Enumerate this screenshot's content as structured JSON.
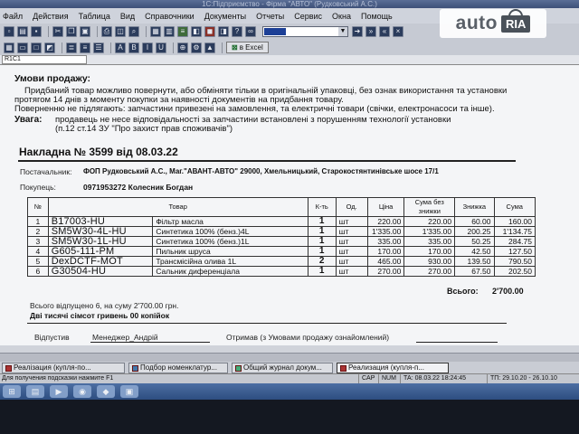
{
  "window": {
    "title": "1С:Підприємство - Фірма \"АВТО\" (Рудковський А.С.)"
  },
  "menu": [
    "Файл",
    "Действия",
    "Таблица",
    "Вид",
    "Справочники",
    "Документы",
    "Отчеты",
    "Сервис",
    "Окна",
    "Помощь"
  ],
  "toolbar": {
    "excel_label": "в Excel",
    "cell_ref": "R1C1"
  },
  "conditions": {
    "title": "Умови продажу:",
    "line1": "Придбаний товар можливо повернути, або обміняти тільки в оригінальній упаковці, без ознак використання та установки",
    "line2": "протягом 14 днів з моменту покупки за наявності документів на придбання товару.",
    "line3": "Поверненню не підлягають: запчастини привезені на замовлення, та електричні товари (свічки, електронасоси та інше).",
    "warning_label": "Увага:",
    "warning1": "продавець не несе відповідальності за запчастини встановлені з порушенням технології установки",
    "warning2": "(п.12 ст.14 ЗУ \"Про захист прав споживачів\")"
  },
  "invoice": {
    "title": "Накладна № 3599 від 08.03.22",
    "supplier_label": "Постачальник:",
    "supplier": "ФОП Рудковський А.С., Маг.\"АВАНТ-АВТО\" 29000, Хмельницький, Старокостянтинівське шосе 17/1",
    "buyer_label": "Покупець:",
    "buyer": "0971953272 Колесник Богдан"
  },
  "table": {
    "headers": [
      "№",
      "Товар",
      "",
      "К-ть",
      "Од.",
      "Ціна",
      "Сума без знижки",
      "Знижка",
      "Сума"
    ],
    "rows": [
      {
        "n": "1",
        "code": "B17003-HU",
        "name": "Фільтр масла",
        "qty": "1",
        "unit": "шт",
        "price": "220.00",
        "sum_nodisc": "220.00",
        "discount": "60.00",
        "sum": "160.00"
      },
      {
        "n": "2",
        "code": "SM5W30-4L-HU",
        "name": "Синтетика 100% (бенз.)4L",
        "qty": "1",
        "unit": "шт",
        "price": "1'335.00",
        "sum_nodisc": "1'335.00",
        "discount": "200.25",
        "sum": "1'134.75"
      },
      {
        "n": "3",
        "code": "SM5W30-1L-HU",
        "name": "Синтетика 100% (бенз.)1L",
        "qty": "1",
        "unit": "шт",
        "price": "335.00",
        "sum_nodisc": "335.00",
        "discount": "50.25",
        "sum": "284.75"
      },
      {
        "n": "4",
        "code": "G605-111-PM",
        "name": "Пильник шруса",
        "qty": "1",
        "unit": "шт",
        "price": "170.00",
        "sum_nodisc": "170.00",
        "discount": "42.50",
        "sum": "127.50"
      },
      {
        "n": "5",
        "code": "DexDCTF-MOT",
        "name": "Трансмісійна олива 1L",
        "qty": "2",
        "unit": "шт",
        "price": "465.00",
        "sum_nodisc": "930.00",
        "discount": "139.50",
        "sum": "790.50"
      },
      {
        "n": "6",
        "code": "G30504-HU",
        "name": "Сальник диференціала",
        "qty": "1",
        "unit": "шт",
        "price": "270.00",
        "sum_nodisc": "270.00",
        "discount": "67.50",
        "sum": "202.50"
      }
    ],
    "total_label": "Всього:",
    "total_value": "2'700.00"
  },
  "summary": {
    "count_line": "Всього відпущено 6, на суму 2'700.00 грн.",
    "in_words": "Дві тисячі сімсот гривень 00 копійок",
    "released_label": "Відпустив",
    "released_by": "Менеджер_Андрій",
    "received_label": "Отримав (з Умовами продажу ознайомлений)"
  },
  "mdi_windows": [
    "Реалізация (купля-по...",
    "Подбор номенклатур...",
    "Общий журнал докум...",
    "Реализация (купля-п..."
  ],
  "statusbar": {
    "hint": "Для получения подсказки нажмите F1",
    "cap": "CAP",
    "num": "NUM",
    "td": "ТА: 08.03.22  18:24:45",
    "tp": "ТП: 29.10.20  -  26.10.10"
  },
  "watermark": {
    "auto": "auto",
    "ria": "RIA"
  }
}
